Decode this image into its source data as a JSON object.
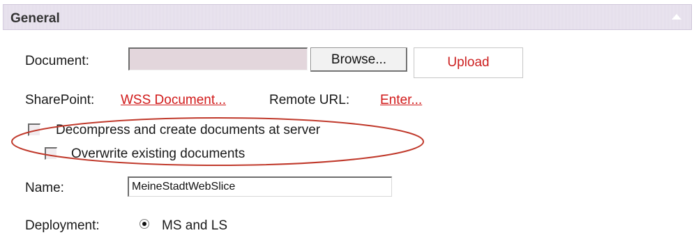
{
  "section": {
    "title": "General"
  },
  "document": {
    "label": "Document:",
    "file_value": "",
    "browse_label": "Browse...",
    "upload_label": "Upload"
  },
  "sharepoint": {
    "label": "SharePoint:",
    "link": "WSS Document...",
    "remote_label": "Remote URL:",
    "remote_link": "Enter..."
  },
  "options": {
    "decompress_label": "Decompress and create documents at server",
    "decompress_checked": false,
    "overwrite_label": "Overwrite existing documents",
    "overwrite_checked": false
  },
  "name": {
    "label": "Name:",
    "value": "MeineStadtWebSlice"
  },
  "deployment": {
    "label": "Deployment:",
    "option_label": "MS and LS",
    "selected": true
  },
  "colors": {
    "header_bg": "#e6dfed",
    "link": "#d11a1a",
    "upload_text": "#cc1f1f",
    "annotation_ellipse": "#c0392b",
    "file_input_bg": "#e3d6dc"
  },
  "icons": {
    "collapse": "chevron-up-icon",
    "radio": "radio-selected-icon"
  }
}
